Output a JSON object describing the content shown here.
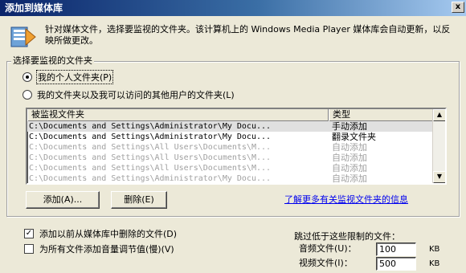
{
  "window": {
    "title": "添加到媒体库",
    "close_label": "x"
  },
  "description": "针对媒体文件，选择要监视的文件夹。该计算机上的 Windows Media Player 媒体库会自动更新，以反映所做更改。",
  "folders_group": {
    "title": "选择要监视的文件夹",
    "option_personal": "我的个人文件夹(P)",
    "option_all": "我的文件夹以及我可以访问的其他用户的文件夹(L)",
    "option_selected": "personal"
  },
  "monitored_list": {
    "col_path": "被监视文件夹",
    "col_type": "类型",
    "rows": [
      {
        "path": "C:\\Documents and Settings\\Administrator\\My Docu...",
        "type": "手动添加"
      },
      {
        "path": "C:\\Documents and Settings\\Administrator\\My Docu...",
        "type": "翻录文件夹"
      },
      {
        "path": "C:\\Documents and Settings\\All Users\\Documents\\M...",
        "type": "自动添加"
      },
      {
        "path": "C:\\Documents and Settings\\All Users\\Documents\\M...",
        "type": "自动添加"
      },
      {
        "path": "C:\\Documents and Settings\\All Users\\Documents\\M...",
        "type": "自动添加"
      },
      {
        "path": "C:\\Documents and Settings\\Administrator\\My Docu...",
        "type": "自动添加"
      }
    ]
  },
  "buttons": {
    "add": "添加(A)...",
    "remove": "删除(E)"
  },
  "learn_more_link": "了解更多有关监视文件夹的信息",
  "options": {
    "add_deleted": "添加以前从媒体库中删除的文件(D)",
    "add_deleted_checked": true,
    "volume_leveling": "为所有文件添加音量调节值(慢)(V)",
    "volume_leveling_checked": false
  },
  "limits": {
    "heading": "跳过低于这些限制的文件：",
    "audio_label": "音频文件(U)：",
    "audio_value": "100",
    "video_label": "视频文件(I)：",
    "video_value": "500",
    "unit": "KB"
  }
}
